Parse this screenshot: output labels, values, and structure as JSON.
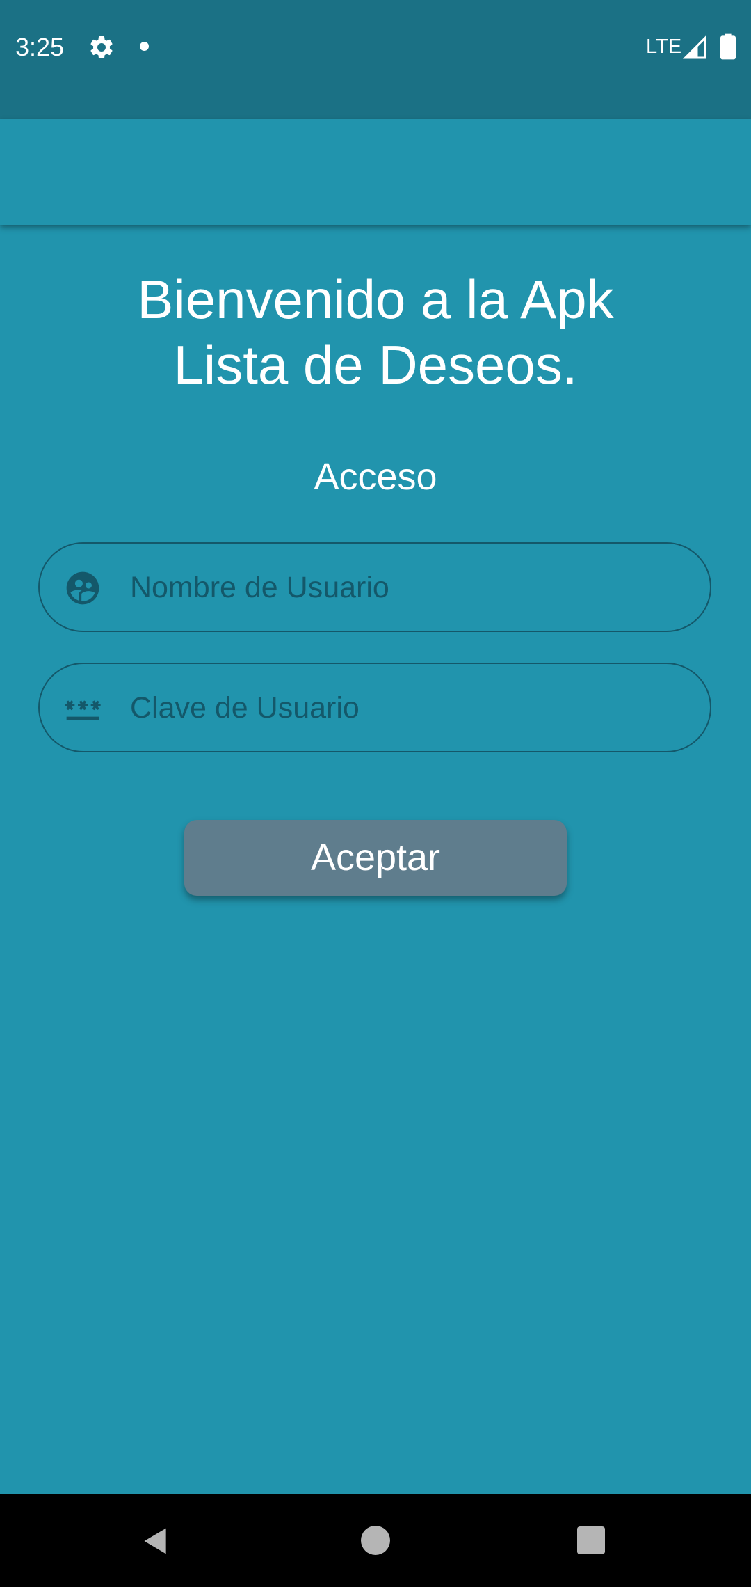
{
  "status_bar": {
    "time": "3:25",
    "network": "LTE",
    "icons": [
      "gear-icon",
      "notification-dot-icon",
      "signal-icon",
      "battery-icon"
    ]
  },
  "content": {
    "title_line1": "Bienvenido a la Apk",
    "title_line2": "Lista de Deseos.",
    "section_title": "Acceso"
  },
  "form": {
    "username": {
      "placeholder": "Nombre de Usuario",
      "value": "",
      "icon": "user-group-icon"
    },
    "password": {
      "placeholder": "Clave de Usuario",
      "value": "",
      "icon": "password-icon"
    },
    "submit_label": "Aceptar"
  },
  "navigation": {
    "icons": [
      "back-icon",
      "home-icon",
      "recents-icon"
    ]
  },
  "colors": {
    "background": "#2194ad",
    "status_bar": "#1b7185",
    "field_border": "#14586a",
    "button": "#5f7d8d"
  }
}
